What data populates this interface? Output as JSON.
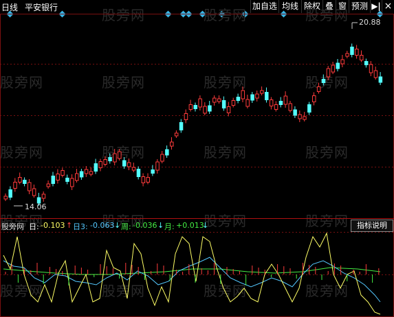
{
  "header": {
    "chart_type_label": "日线",
    "stock_name": "平安银行",
    "buttons": [
      "加自选",
      "均线",
      "除权",
      "叠",
      "窗",
      "预测"
    ],
    "nav_icon": "arrow-right-bar-icon",
    "close_label": "×"
  },
  "price_chart": {
    "high_label": "20.88",
    "low_label": "14.06",
    "up_color": "#ff3b3b",
    "down_color": "#54ffff"
  },
  "indicator": {
    "name": "股旁网",
    "day_label": "日:",
    "day_value": "-0.103",
    "day_arrow": "↑",
    "day3_label": "日3:",
    "day3_value": "-0.063",
    "day3_arrow": "↓",
    "week_label": "周:",
    "week_value": "-0.036",
    "week_arrow": "↓",
    "month_label": "月:",
    "month_value": "+0.013",
    "month_arrow": "↓",
    "button_label": "指标说明"
  },
  "watermark": "股旁网"
}
